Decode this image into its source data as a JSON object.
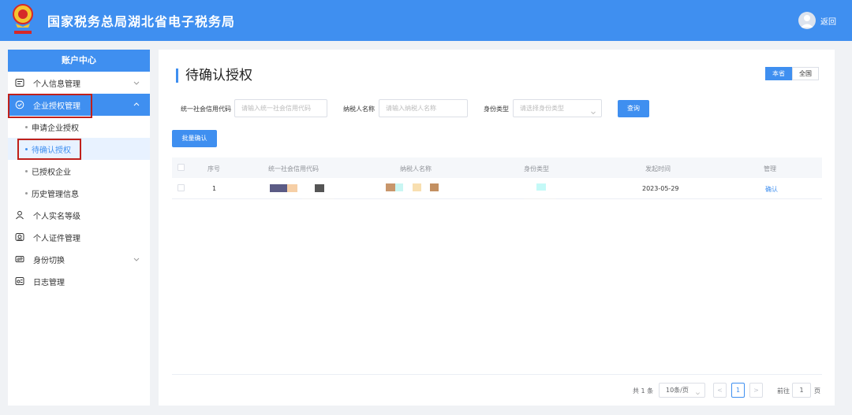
{
  "header": {
    "title": "国家税务总局湖北省电子税务局",
    "back_label": "返回"
  },
  "sidebar": {
    "title": "账户中心",
    "items": [
      {
        "label": "个人信息管理"
      },
      {
        "label": "企业授权管理"
      },
      {
        "label": "申请企业授权"
      },
      {
        "label": "待确认授权"
      },
      {
        "label": "已授权企业"
      },
      {
        "label": "历史管理信息"
      },
      {
        "label": "个人实名等级"
      },
      {
        "label": "个人证件管理"
      },
      {
        "label": "身份切换"
      },
      {
        "label": "日志管理"
      }
    ]
  },
  "main": {
    "title": "待确认授权",
    "region_toggle": [
      "本省",
      "全国"
    ],
    "filters": {
      "credit_code_label": "统一社会信用代码",
      "credit_code_placeholder": "请输入统一社会信用代码",
      "taxpayer_label": "纳税人名称",
      "taxpayer_placeholder": "请输入纳税人名称",
      "identity_label": "身份类型",
      "identity_placeholder": "请选择身份类型",
      "query_button": "查询"
    },
    "batch_button": "批量确认",
    "table": {
      "columns": [
        "序号",
        "统一社会信用代码",
        "纳税人名称",
        "身份类型",
        "发起时间",
        "管理"
      ],
      "rows": [
        {
          "index": "1",
          "time": "2023-05-29",
          "action": "确认"
        }
      ]
    },
    "pagination": {
      "total": "共 1 条",
      "page_size": "10条/页",
      "prev": "<",
      "current": "1",
      "next": ">",
      "goto_label": "前往",
      "goto_value": "1",
      "goto_suffix": "页"
    }
  },
  "colors": {
    "primary": "#3f8ff0",
    "highlight": "#c0201b"
  }
}
